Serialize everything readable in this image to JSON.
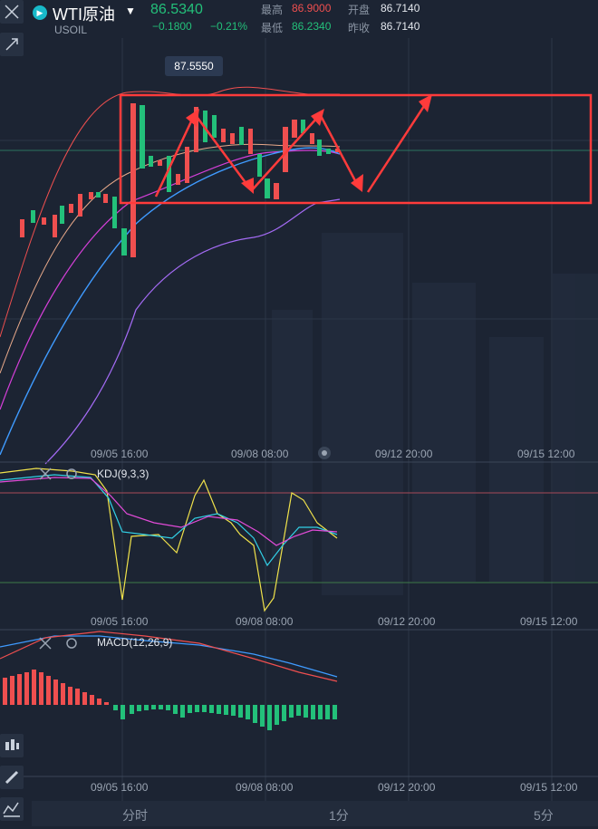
{
  "header": {
    "title": "WTI原油",
    "symbol": "USOIL",
    "price": "86.5340",
    "change": "−0.1800",
    "change_pct": "−0.21%",
    "high_label": "最高",
    "high_value": "86.9000",
    "low_label": "最低",
    "low_value": "86.2340",
    "open_label": "开盘",
    "open_value": "86.7140",
    "prev_close_label": "昨收",
    "prev_close_value": "86.7140"
  },
  "chart": {
    "price_tag": "87.5550",
    "time_labels": [
      "09/05 16:00",
      "09/08 08:00",
      "09/12 20:00",
      "09/15 12:00"
    ],
    "kdj_label": "KDJ(9,3,3)",
    "macd_label": "MACD(12,26,9)"
  },
  "bottom_tabs": [
    "分时",
    "1分",
    "5分"
  ],
  "colors": {
    "up": "#ef4f4f",
    "down": "#23c07a",
    "annotation": "#ff3b3b"
  }
}
